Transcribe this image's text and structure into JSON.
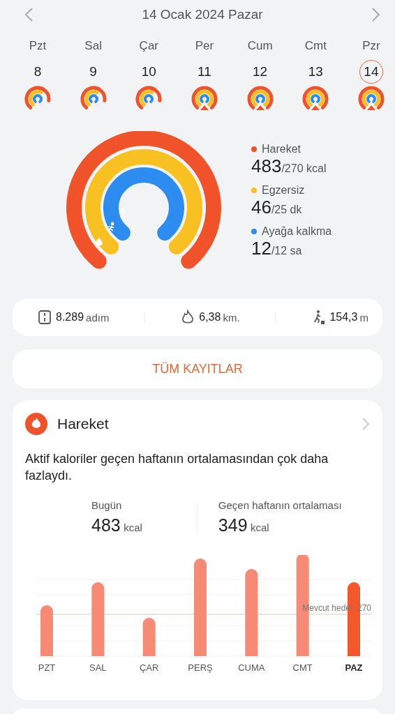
{
  "header": {
    "title": "14 Ocak 2024 Pazar"
  },
  "days": [
    {
      "weekday": "Pzt",
      "date": "8",
      "selected": false,
      "goal_met": false
    },
    {
      "weekday": "Sal",
      "date": "9",
      "selected": false,
      "goal_met": false
    },
    {
      "weekday": "Çar",
      "date": "10",
      "selected": false,
      "goal_met": false
    },
    {
      "weekday": "Per",
      "date": "11",
      "selected": false,
      "goal_met": true
    },
    {
      "weekday": "Cum",
      "date": "12",
      "selected": false,
      "goal_met": true
    },
    {
      "weekday": "Cmt",
      "date": "13",
      "selected": false,
      "goal_met": true
    },
    {
      "weekday": "Pzr",
      "date": "14",
      "selected": true,
      "goal_met": true
    }
  ],
  "rings": [
    {
      "kind": "move",
      "label": "Hareket",
      "value": "483",
      "goal": "/270 kcal",
      "color": "#f0522a"
    },
    {
      "kind": "exercise",
      "label": "Egzersiz",
      "value": "46",
      "goal": "/25 dk",
      "color": "#f8c021"
    },
    {
      "kind": "stand",
      "label": "Ayağa kalkma",
      "value": "12",
      "goal": "/12 sa",
      "color": "#2d8cf0"
    }
  ],
  "stats": [
    {
      "kind": "steps",
      "value": "8.289",
      "unit": "adım"
    },
    {
      "kind": "distance",
      "value": "6,38",
      "unit": "km."
    },
    {
      "kind": "climb",
      "value": "154,3",
      "unit": "m"
    }
  ],
  "all_records_button": "TÜM KAYITLAR",
  "move_card": {
    "title": "Hareket",
    "message": "Aktif kaloriler geçen haftanın ortalamasından çok daha fazlaydı.",
    "today": {
      "label": "Bugün",
      "value": "483",
      "unit": "kcal"
    },
    "average": {
      "label": "Geçen haftanın ortalaması",
      "value": "349",
      "unit": "kcal"
    },
    "goal_label": "Mevcut hedef: 270",
    "bars": [
      {
        "label": "PZT",
        "selected": false
      },
      {
        "label": "SAL",
        "selected": false
      },
      {
        "label": "ÇAR",
        "selected": false
      },
      {
        "label": "PERŞ",
        "selected": false
      },
      {
        "label": "CUMA",
        "selected": false
      },
      {
        "label": "CMT",
        "selected": false
      },
      {
        "label": "PAZ",
        "selected": true
      }
    ]
  }
}
